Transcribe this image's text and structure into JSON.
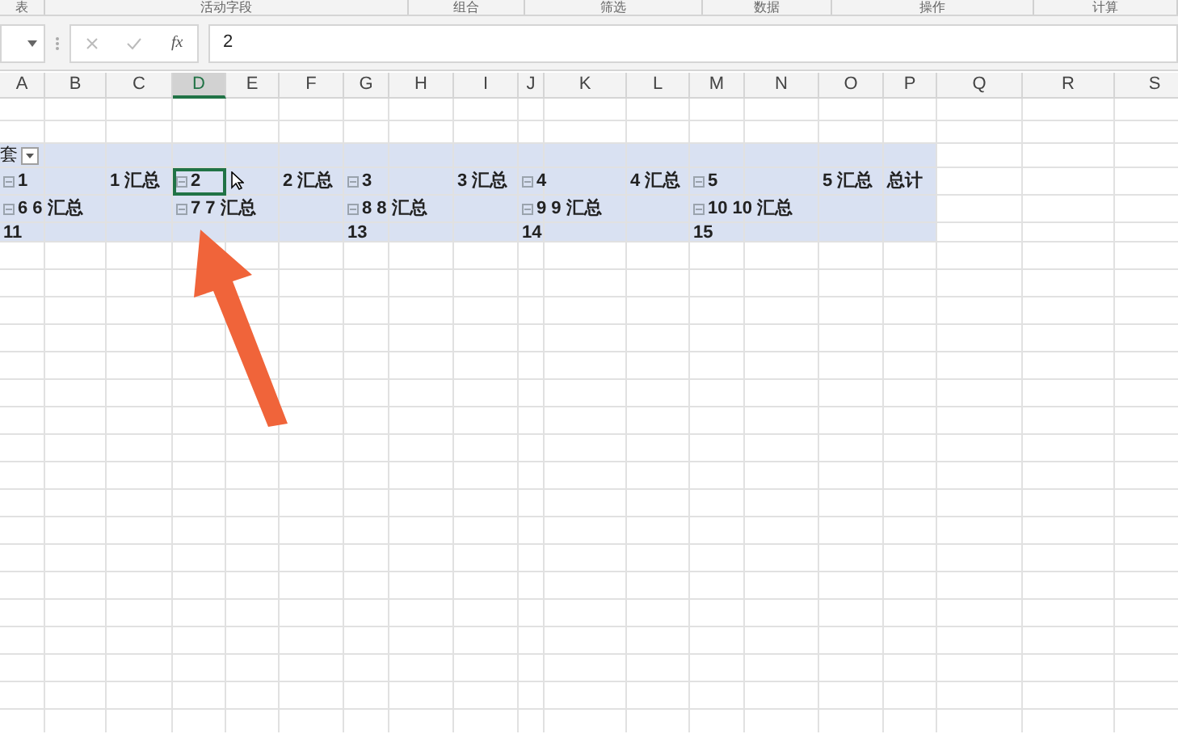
{
  "ribbon_groups": [
    "表",
    "活动字段",
    "组合",
    "筛选",
    "数据",
    "操作",
    "计算"
  ],
  "formula_bar": {
    "function_label": "fx",
    "value": "2"
  },
  "columns": [
    {
      "label": "A",
      "selected": false
    },
    {
      "label": "B",
      "selected": false
    },
    {
      "label": "C",
      "selected": false
    },
    {
      "label": "D",
      "selected": true
    },
    {
      "label": "E",
      "selected": false
    },
    {
      "label": "F",
      "selected": false
    },
    {
      "label": "G",
      "selected": false
    },
    {
      "label": "H",
      "selected": false
    },
    {
      "label": "I",
      "selected": false
    },
    {
      "label": "J",
      "selected": false
    },
    {
      "label": "K",
      "selected": false
    },
    {
      "label": "L",
      "selected": false
    },
    {
      "label": "M",
      "selected": false
    },
    {
      "label": "N",
      "selected": false
    },
    {
      "label": "O",
      "selected": false
    },
    {
      "label": "P",
      "selected": false
    },
    {
      "label": "Q",
      "selected": false
    },
    {
      "label": "R",
      "selected": false
    },
    {
      "label": "S",
      "selected": false
    }
  ],
  "pivot_rows": [
    {
      "cells": [
        {
          "text": "套",
          "kind": "filter"
        }
      ]
    },
    {
      "cells": [
        {
          "text": "1",
          "kind": "group",
          "expanded": true,
          "selected": false
        },
        {
          "text": "1 汇总",
          "kind": "total"
        },
        {
          "text": "2",
          "kind": "group",
          "expanded": true,
          "selected": true
        },
        {
          "text": "2 汇总",
          "kind": "total"
        },
        {
          "text": "3",
          "kind": "group",
          "expanded": true,
          "selected": false
        },
        {
          "text": "3 汇总",
          "kind": "total"
        },
        {
          "text": "4",
          "kind": "group",
          "expanded": true,
          "selected": false
        },
        {
          "text": "4 汇总",
          "kind": "total"
        },
        {
          "text": "5",
          "kind": "group",
          "expanded": true,
          "selected": false
        },
        {
          "text": "5 汇总",
          "kind": "total"
        },
        {
          "text": "总计",
          "kind": "total"
        }
      ]
    },
    {
      "cells": [
        {
          "text": "6 6 汇总",
          "kind": "group",
          "expanded": true,
          "selected": false
        },
        {
          "text": "7 7 汇总",
          "kind": "group",
          "expanded": true,
          "selected": false
        },
        {
          "text": "8 8 汇总",
          "kind": "group",
          "expanded": true,
          "selected": false
        },
        {
          "text": "9 9 汇总",
          "kind": "group",
          "expanded": true,
          "selected": false
        },
        {
          "text": "10 10 汇总",
          "kind": "group",
          "expanded": true,
          "selected": false
        }
      ]
    },
    {
      "cells": [
        {
          "text": "11",
          "kind": "total"
        },
        {
          "text": "13",
          "kind": "total"
        },
        {
          "text": "14",
          "kind": "total"
        },
        {
          "text": "15",
          "kind": "total"
        }
      ]
    }
  ]
}
